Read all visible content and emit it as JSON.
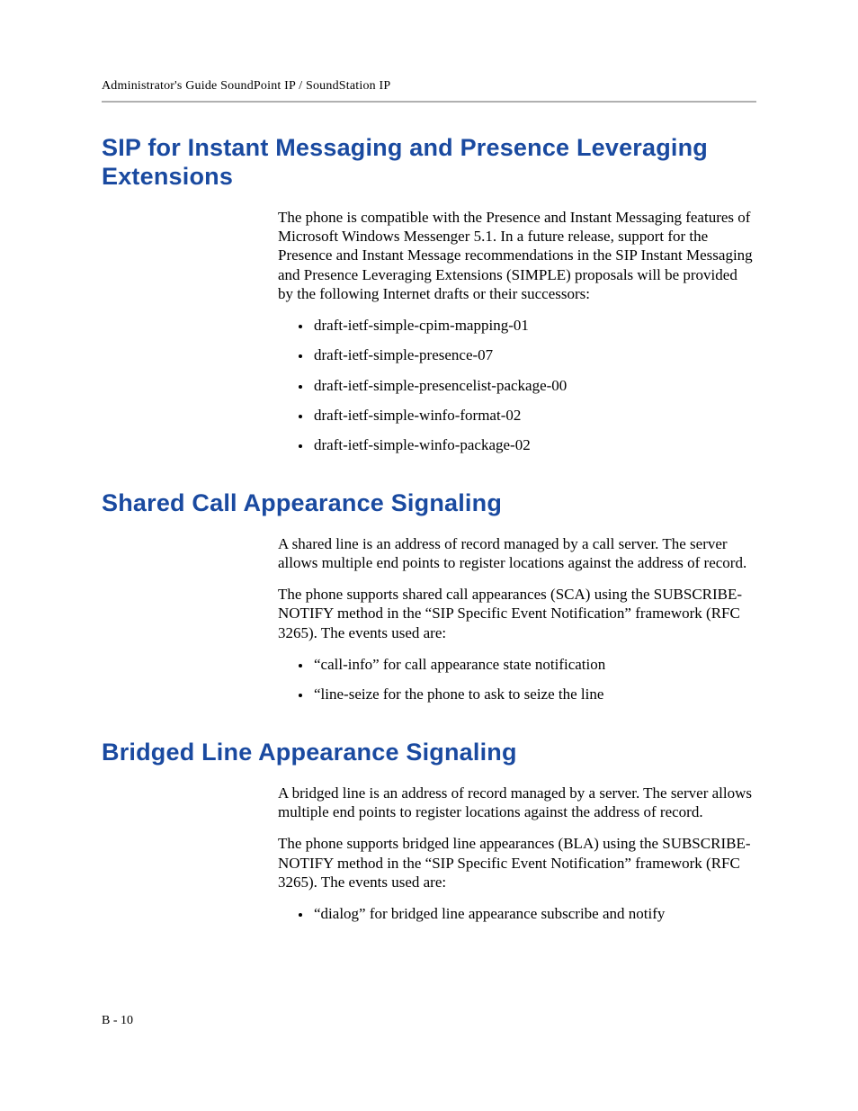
{
  "header": {
    "running_head": "Administrator's Guide SoundPoint IP / SoundStation IP"
  },
  "sections": [
    {
      "title": "SIP for Instant Messaging and Presence Leveraging Extensions",
      "paragraphs": [
        "The phone is compatible with the Presence and Instant Messaging features of Microsoft Windows Messenger 5.1. In a future release, support for the Presence and Instant Message recommendations in the SIP Instant Messaging and Presence Leveraging Extensions (SIMPLE) proposals will be provided by the following Internet drafts or their successors:"
      ],
      "list": [
        "draft-ietf-simple-cpim-mapping-01",
        "draft-ietf-simple-presence-07",
        "draft-ietf-simple-presencelist-package-00",
        "draft-ietf-simple-winfo-format-02",
        "draft-ietf-simple-winfo-package-02"
      ]
    },
    {
      "title": "Shared Call Appearance Signaling",
      "paragraphs": [
        "A shared line is an address of record managed by a call server. The server allows multiple end points to register locations against the address of record.",
        "The phone supports shared call appearances (SCA) using the SUBSCRIBE-NOTIFY method in the “SIP Specific Event Notification” framework (RFC 3265). The events used are:"
      ],
      "list": [
        "“call-info” for call appearance state notification",
        "“line-seize for the phone to ask to seize the line"
      ]
    },
    {
      "title": "Bridged Line Appearance Signaling",
      "paragraphs": [
        "A bridged line is an address of record managed by a server. The server allows multiple end points to register locations against the address of record.",
        "The phone supports bridged line appearances (BLA) using the SUBSCRIBE-NOTIFY method in the “SIP Specific Event Notification” framework (RFC 3265). The events used are:"
      ],
      "list": [
        "“dialog” for bridged line appearance subscribe and notify"
      ]
    }
  ],
  "footer": {
    "page_number": "B - 10"
  }
}
